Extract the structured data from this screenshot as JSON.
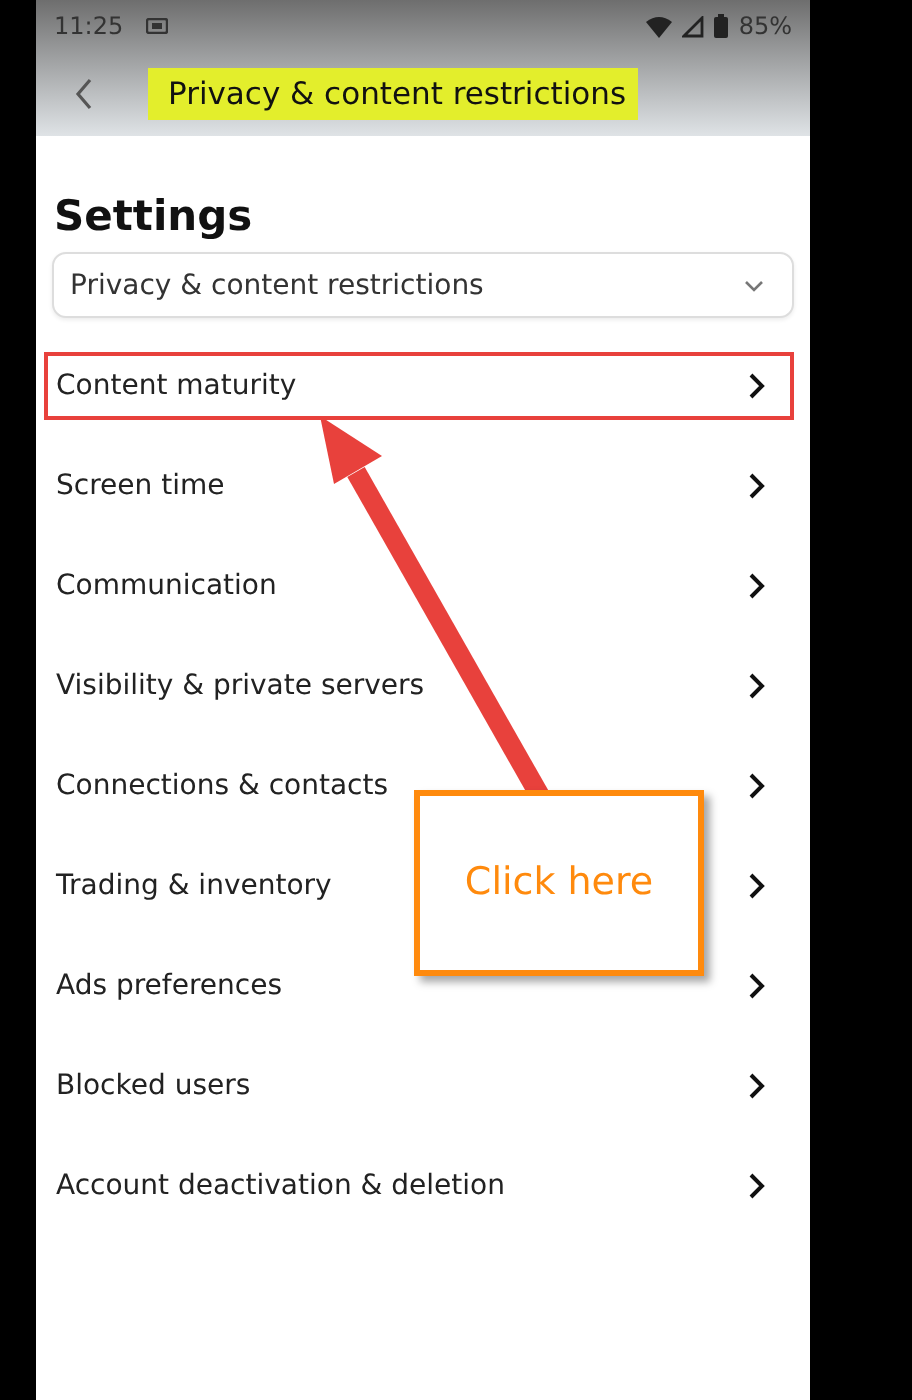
{
  "status_bar": {
    "time": "11:25",
    "battery": "85%"
  },
  "header": {
    "title": "Privacy & content restrictions",
    "title_highlighted": true
  },
  "heading": "Settings",
  "dropdown": {
    "value": "Privacy & content restrictions"
  },
  "items": [
    {
      "label": "Content maturity",
      "highlighted": true
    },
    {
      "label": "Screen time",
      "highlighted": false
    },
    {
      "label": "Communication",
      "highlighted": false
    },
    {
      "label": "Visibility & private servers",
      "highlighted": false
    },
    {
      "label": "Connections & contacts",
      "highlighted": false
    },
    {
      "label": "Trading & inventory",
      "highlighted": false
    },
    {
      "label": "Ads preferences",
      "highlighted": false
    },
    {
      "label": "Blocked users",
      "highlighted": false
    },
    {
      "label": "Account deactivation & deletion",
      "highlighted": false
    }
  ],
  "callout": {
    "text": "Click here"
  }
}
